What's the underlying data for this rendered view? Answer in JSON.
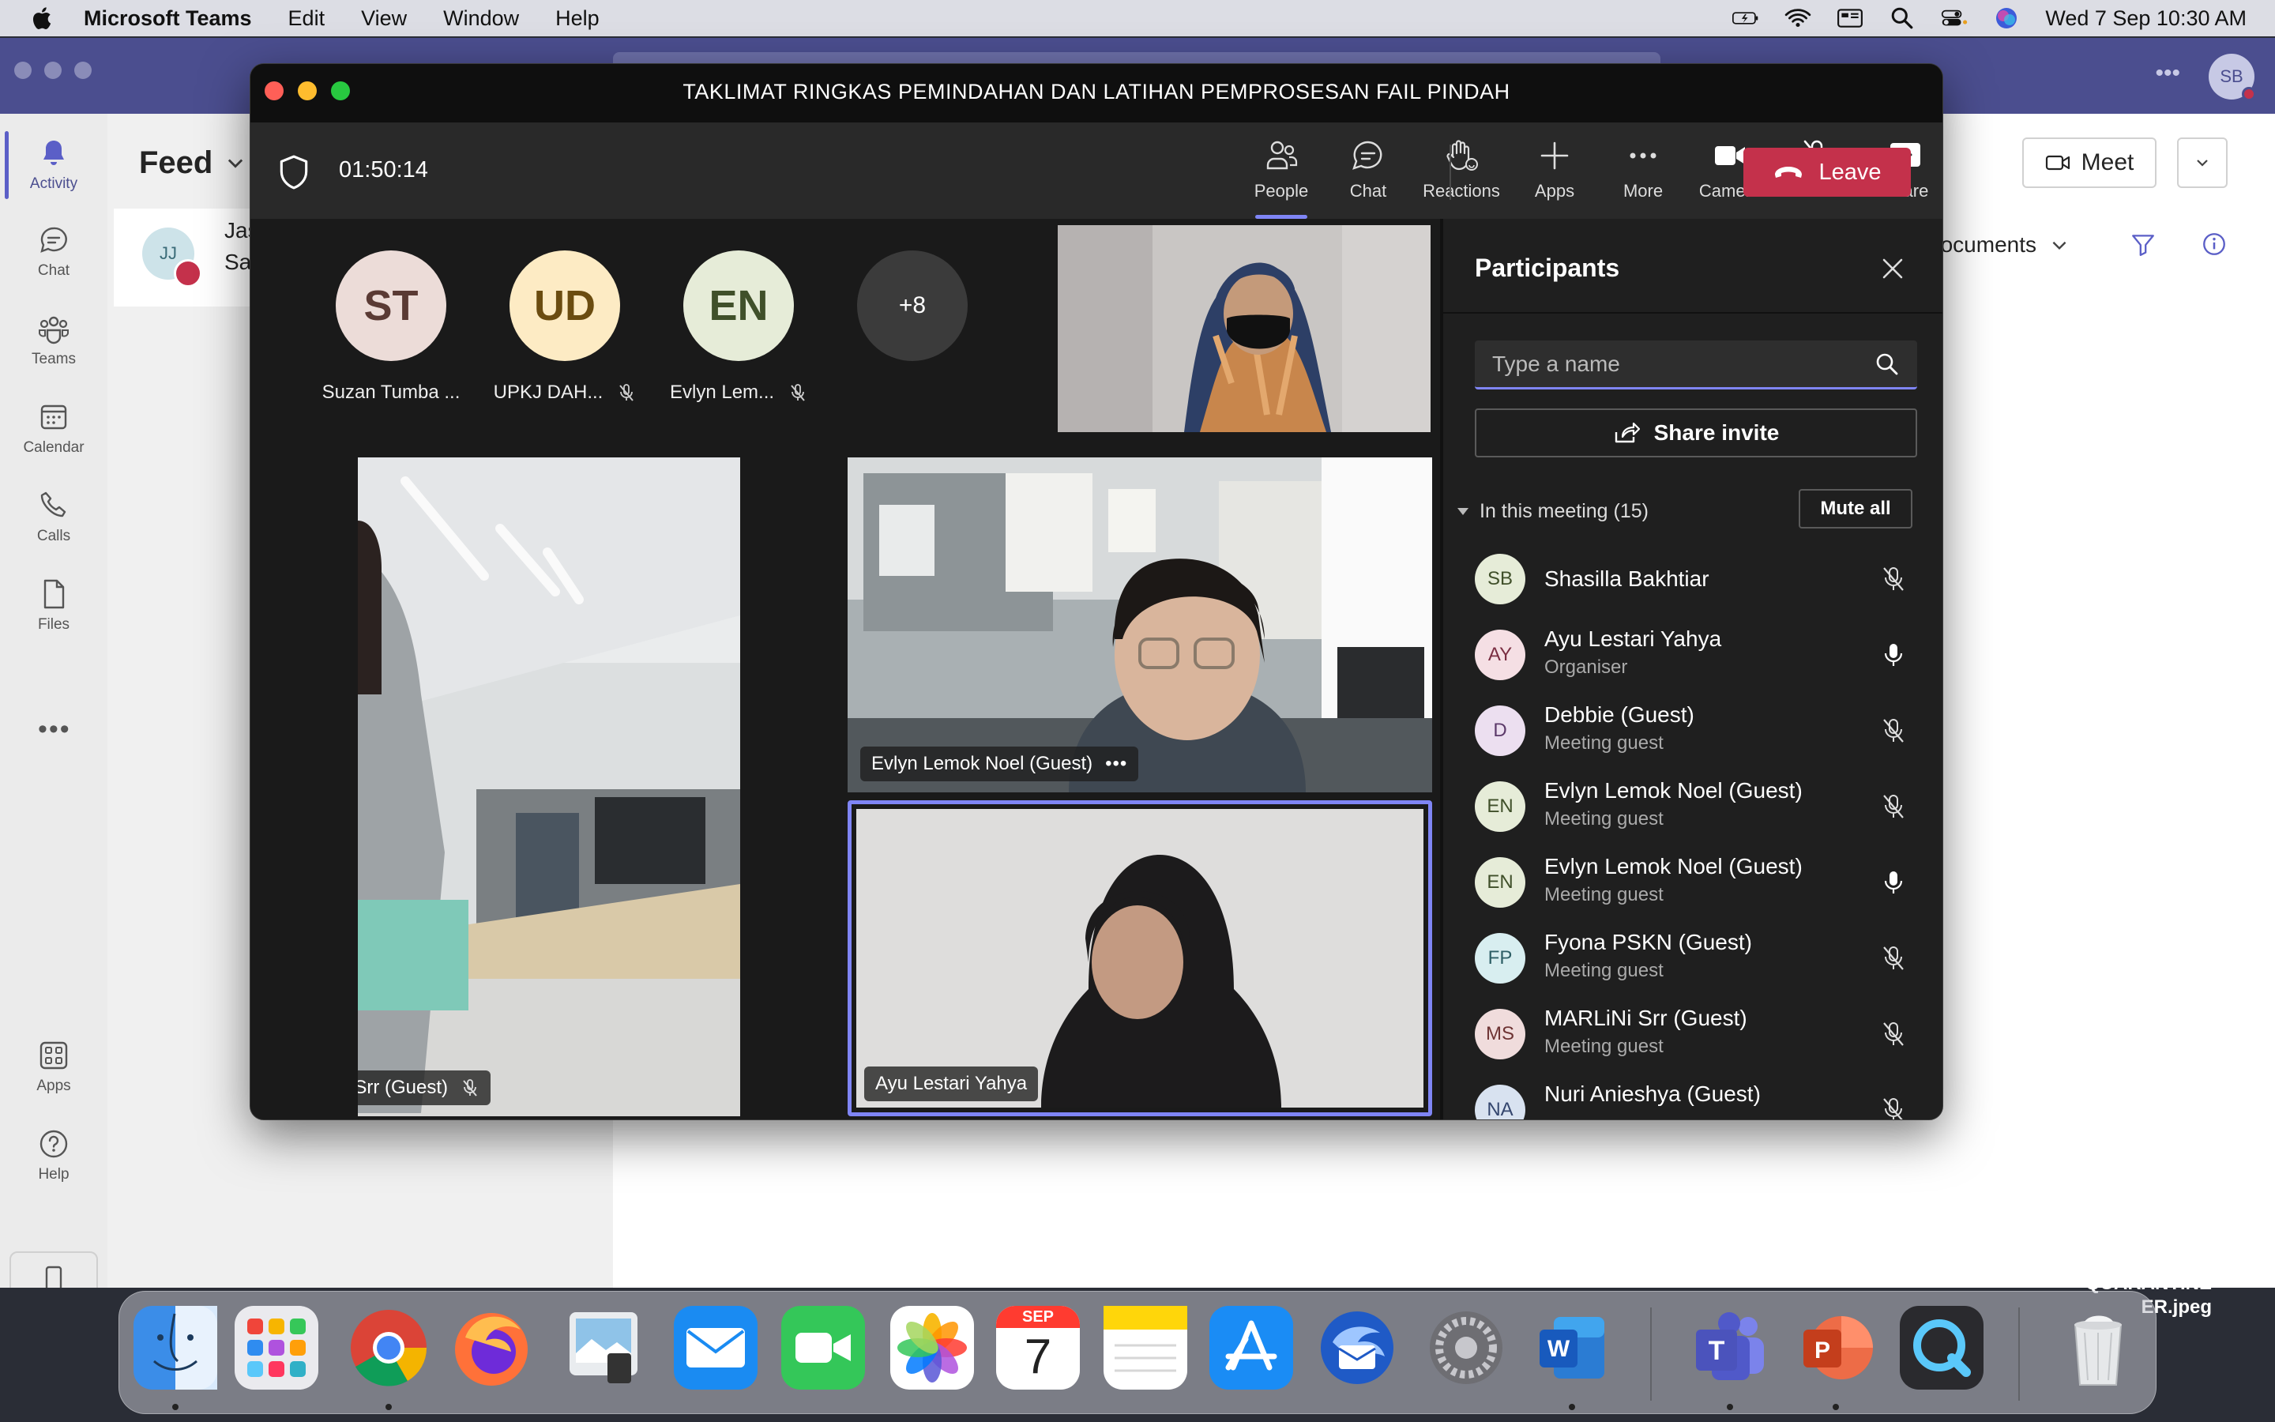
{
  "menubar": {
    "app_name": "Microsoft Teams",
    "menus": [
      "Edit",
      "View",
      "Window",
      "Help"
    ],
    "clock": "Wed 7 Sep  10:30 AM"
  },
  "teams": {
    "avatar_initials": "SB",
    "rail": {
      "activity": "Activity",
      "chat": "Chat",
      "teams": "Teams",
      "calendar": "Calendar",
      "calls": "Calls",
      "files": "Files",
      "apps": "Apps",
      "help": "Help"
    },
    "feed": {
      "title": "Feed",
      "item_initials": "JJ",
      "item_line1": "Jas",
      "item_line2": "Sar"
    },
    "main": {
      "meet_label": "Meet",
      "documents_label": "Documents"
    }
  },
  "meeting": {
    "title": "TAKLIMAT RINGKAS PEMINDAHAN DAN LATIHAN PEMPROSESAN FAIL PINDAH",
    "timer": "01:50:14",
    "toolbar": {
      "people": "People",
      "chat": "Chat",
      "reactions": "Reactions",
      "apps": "Apps",
      "more": "More",
      "camera": "Camera",
      "mic": "Mic",
      "share": "Share",
      "leave": "Leave"
    },
    "strip": [
      {
        "initials": "ST",
        "name": "Suzan Tumba ...",
        "bg": "#ecdcd8",
        "fg": "#5a3a34"
      },
      {
        "initials": "UD",
        "name": "UPKJ DAH...",
        "bg": "#fdebc4",
        "fg": "#6b4c10"
      },
      {
        "initials": "EN",
        "name": "Evlyn Lem...",
        "bg": "#e6ecd8",
        "fg": "#40502a"
      },
      {
        "initials": "+8",
        "name": "",
        "bg": "#3b3b3b",
        "fg": "#ffffff"
      }
    ],
    "tiles": {
      "left_label": "MARLiNi Srr (Guest)",
      "mid_label": "Evlyn Lemok Noel (Guest)",
      "bottom_label": "Ayu Lestari Yahya"
    }
  },
  "participants": {
    "title": "Participants",
    "search_placeholder": "Type a name",
    "share_invite": "Share invite",
    "section": "In this meeting (15)",
    "mute_all": "Mute all",
    "list": [
      {
        "initials": "SB",
        "name": "Shasilla Bakhtiar",
        "role": "",
        "mic": "muted",
        "bg": "#e6ecd8",
        "fg": "#40502a"
      },
      {
        "initials": "AY",
        "name": "Ayu Lestari Yahya",
        "role": "Organiser",
        "mic": "on",
        "bg": "#f5dfe4",
        "fg": "#7a2e42"
      },
      {
        "initials": "D",
        "name": "Debbie (Guest)",
        "role": "Meeting guest",
        "mic": "muted",
        "bg": "#ecdff0",
        "fg": "#5c3a6a"
      },
      {
        "initials": "EN",
        "name": "Evlyn Lemok Noel (Guest)",
        "role": "Meeting guest",
        "mic": "muted",
        "bg": "#e6ecd8",
        "fg": "#40502a"
      },
      {
        "initials": "EN",
        "name": "Evlyn Lemok Noel (Guest)",
        "role": "Meeting guest",
        "mic": "on",
        "bg": "#e6ecd8",
        "fg": "#40502a"
      },
      {
        "initials": "FP",
        "name": "Fyona PSKN (Guest)",
        "role": "Meeting guest",
        "mic": "muted",
        "bg": "#d8eef0",
        "fg": "#2e5f66"
      },
      {
        "initials": "MS",
        "name": "MARLiNi Srr (Guest)",
        "role": "Meeting guest",
        "mic": "muted",
        "bg": "#f0dcdc",
        "fg": "#6e3434"
      },
      {
        "initials": "NA",
        "name": "Nuri Anieshya (Guest)",
        "role": "",
        "mic": "muted",
        "bg": "#d8e2f0",
        "fg": "#34466e"
      }
    ]
  },
  "desktop": {
    "file_label_1": "QUARANTINE",
    "file_label_2": "ER.jpeg"
  },
  "dock": {
    "calendar_month": "SEP",
    "calendar_day": "7"
  }
}
